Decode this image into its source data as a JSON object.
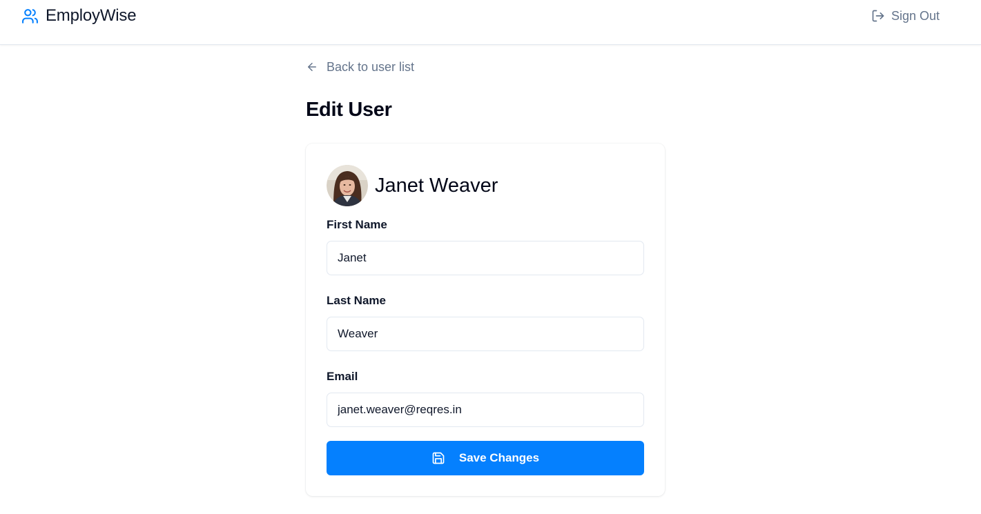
{
  "header": {
    "brand_name": "EmployWise",
    "brand_icon": "users-icon",
    "signout_label": "Sign Out",
    "signout_icon": "log-out-icon"
  },
  "nav": {
    "back_label": "Back to user list",
    "back_icon": "arrow-left-icon"
  },
  "page": {
    "title": "Edit User"
  },
  "user": {
    "full_name": "Janet Weaver",
    "avatar": "avatar-photo"
  },
  "form": {
    "first_name": {
      "label": "First Name",
      "value": "Janet"
    },
    "last_name": {
      "label": "Last Name",
      "value": "Weaver"
    },
    "email": {
      "label": "Email",
      "value": "janet.weaver@reqres.in"
    },
    "save_label": "Save Changes",
    "save_icon": "save-icon"
  },
  "colors": {
    "accent": "#0580fe",
    "muted_text": "#64748b",
    "border": "#e2e8f0"
  }
}
